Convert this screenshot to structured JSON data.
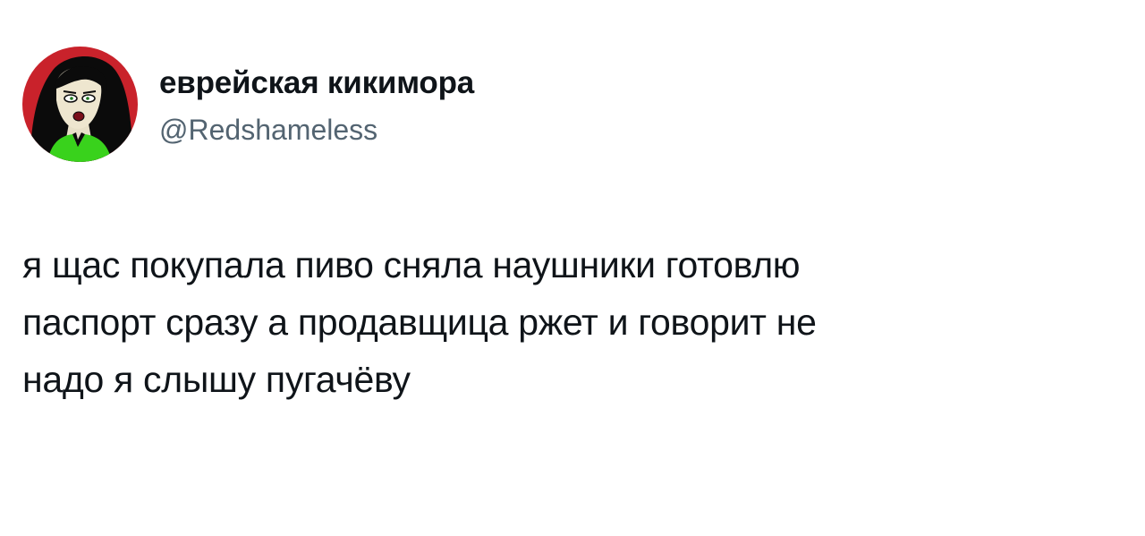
{
  "author": {
    "display_name": "еврейская кикимора",
    "handle": "@Redshameless",
    "avatar_icon": "cartoon-character-avatar-icon"
  },
  "tweet": {
    "lines": [
      "я щас покупала пиво сняла наушники готовлю",
      "паспорт сразу а продавщица ржет и говорит не",
      "надо я слышу пугачёву"
    ]
  },
  "colors": {
    "text_primary": "#0f1419",
    "text_secondary": "#536471",
    "background": "#ffffff",
    "avatar_background": "#c9222b",
    "avatar_accent": "#39d21c"
  }
}
